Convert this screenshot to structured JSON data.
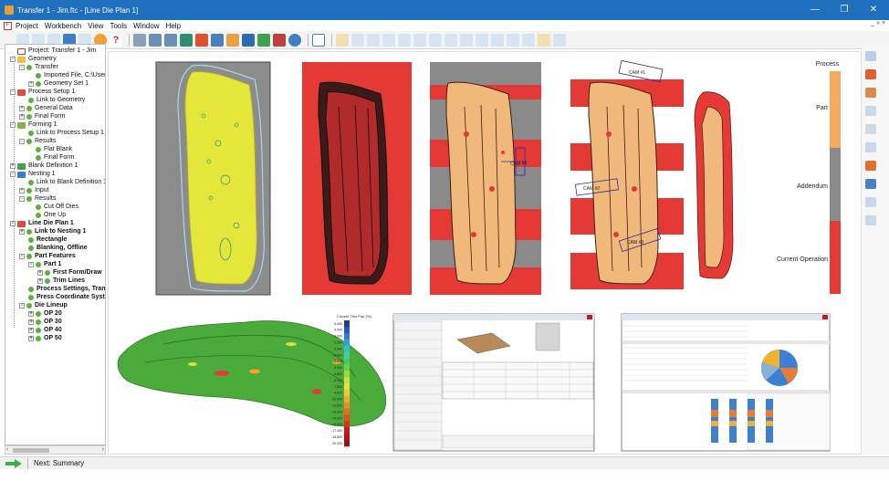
{
  "window": {
    "title": "Transfer 1 - Jim.ftc - [Line Die Plan 1]"
  },
  "window_controls": {
    "minimize": "—",
    "maximize": "❐",
    "close": "✕",
    "mdi": "_ » ×"
  },
  "menu": {
    "items": [
      "Project",
      "Workbench",
      "View",
      "Tools",
      "Window",
      "Help"
    ]
  },
  "tree": {
    "nodes": [
      {
        "label": "Project: Transfer 1 - Jim",
        "icon": "project-icon"
      },
      {
        "label": "Geometry",
        "icon": "folder-icon"
      },
      {
        "label": "Transfer",
        "icon": "dot-icon"
      },
      {
        "label": "Imported File, C:\\User",
        "icon": "dot-icon"
      },
      {
        "label": "Geometry Set 1",
        "icon": "dot-icon"
      },
      {
        "label": "Process Setup 1",
        "icon": "process-icon"
      },
      {
        "label": "Link to Geometry",
        "icon": "dot-icon"
      },
      {
        "label": "General Data",
        "icon": "dot-icon"
      },
      {
        "label": "Final Form",
        "icon": "dot-icon"
      },
      {
        "label": "Forming 1",
        "icon": "forming-icon"
      },
      {
        "label": "Link to Process Setup 1",
        "icon": "dot-icon"
      },
      {
        "label": "Results",
        "icon": "dot-icon"
      },
      {
        "label": "Flat Blank",
        "icon": "dot-icon"
      },
      {
        "label": "Final Form",
        "icon": "dot-icon"
      },
      {
        "label": "Blank Definition 1",
        "icon": "blank-icon"
      },
      {
        "label": "Nesting 1",
        "icon": "nesting-icon"
      },
      {
        "label": "Link to Blank Definition 1",
        "icon": "dot-icon"
      },
      {
        "label": "Input",
        "icon": "dot-icon"
      },
      {
        "label": "Results",
        "icon": "dot-icon"
      },
      {
        "label": "Cut Off Dies",
        "icon": "dot-icon"
      },
      {
        "label": "One Up",
        "icon": "dot-icon"
      },
      {
        "label": "Line Die Plan 1",
        "icon": "lineplan-icon"
      },
      {
        "label": "Link to Nesting 1",
        "icon": "dot-icon"
      },
      {
        "label": "Rectangle",
        "icon": "dot-icon"
      },
      {
        "label": "Blanking, Offline",
        "icon": "dot-icon"
      },
      {
        "label": "Part Features",
        "icon": "dot-icon"
      },
      {
        "label": "Part 1",
        "icon": "dot-icon"
      },
      {
        "label": "First Form/Draw",
        "icon": "dot-icon"
      },
      {
        "label": "Trim Lines",
        "icon": "dot-icon"
      },
      {
        "label": "Process Settings, Transfe",
        "icon": "dot-icon"
      },
      {
        "label": "Press Coordinate System",
        "icon": "dot-icon"
      },
      {
        "label": "Die Lineup",
        "icon": "dot-icon"
      },
      {
        "label": "OP 20",
        "icon": "dot-icon"
      },
      {
        "label": "OP 30",
        "icon": "dot-icon"
      },
      {
        "label": "OP 40",
        "icon": "dot-icon"
      },
      {
        "label": "OP 50",
        "icon": "dot-icon"
      }
    ]
  },
  "die_legend": {
    "labels": [
      "Process",
      "Part",
      "Addendum",
      "Current Operation"
    ],
    "colors": {
      "process": "#f4a860",
      "part": "#f4a860",
      "addendum": "#8a8a8a",
      "current": "#e53935"
    }
  },
  "thinning_legend": {
    "title": "Current Thin Pop (%)",
    "ticks": [
      "6.400",
      "5.000",
      "3.600",
      "2.200",
      "0.800",
      "-0.600",
      "-2.000",
      "-3.400",
      "-4.800",
      "-6.200",
      "-7.600",
      "-9.000",
      "-10.400",
      "-11.800",
      "-13.200",
      "-14.600",
      "-16.000",
      "-17.400",
      "-18.800",
      "-20.200"
    ]
  },
  "callouts": [
    "CAM #1",
    "CAM #2",
    "CAM #3",
    "CAM #4"
  ],
  "status": {
    "next_label": "Next: Summary"
  },
  "colors": {
    "accent": "#1f6fbf",
    "tree_dot": "#59b33a",
    "blank_yellow": "#e4e63a",
    "part_orange": "#f0b87a",
    "red": "#e53935"
  }
}
